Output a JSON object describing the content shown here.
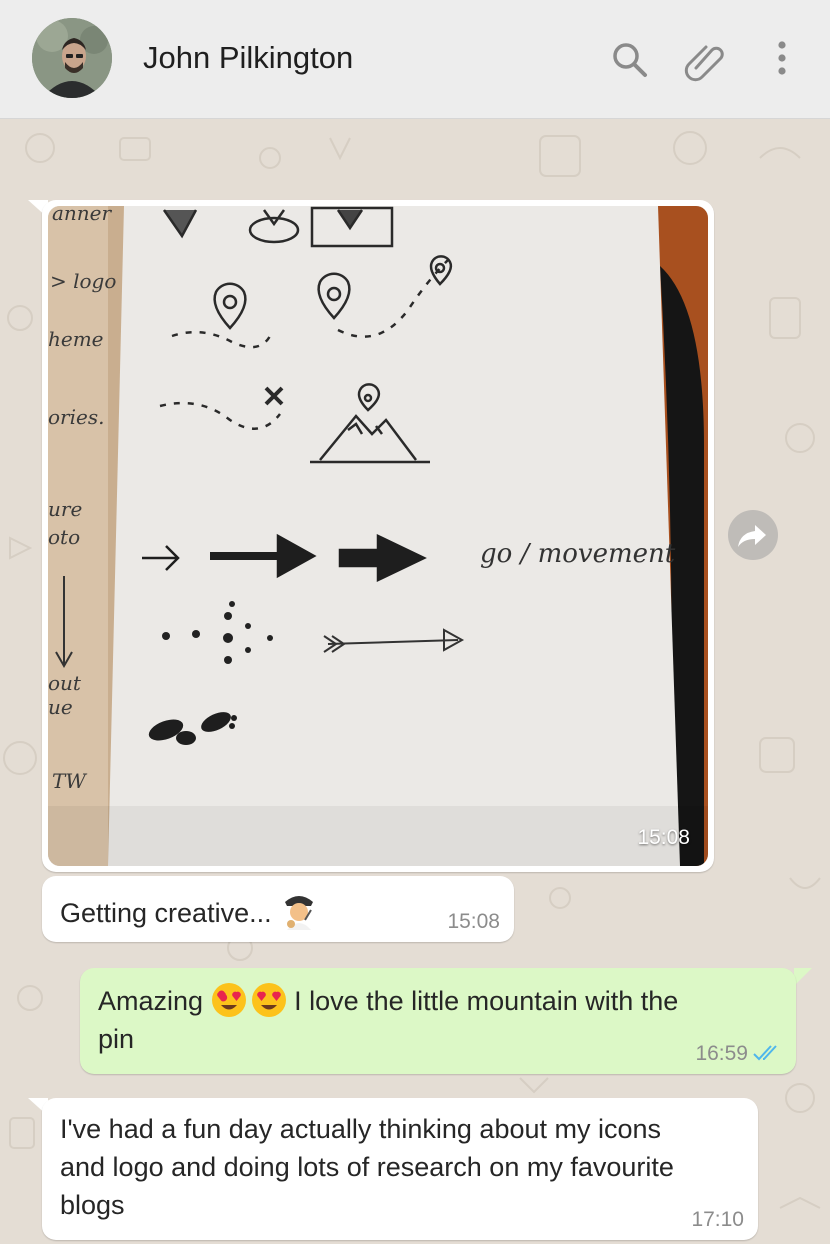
{
  "header": {
    "contact_name": "John Pilkington",
    "icons": [
      "search-icon",
      "paperclip-icon",
      "more-vertical-icon"
    ]
  },
  "messages": [
    {
      "direction": "incoming",
      "type": "image",
      "time": "15:08"
    },
    {
      "direction": "incoming",
      "type": "text",
      "text": "Getting creative...",
      "emoji": "artist",
      "time": "15:08"
    },
    {
      "direction": "outgoing",
      "type": "text",
      "text_before": "Amazing",
      "emoji": "heart-eyes x2",
      "text_line1_after": "I love the little mountain with the",
      "text_line2": "pin",
      "time": "16:59",
      "status": "read"
    },
    {
      "direction": "incoming",
      "type": "text",
      "lines": [
        "I've had a fun day actually thinking about my icons",
        "and logo and doing lots of research on my favourite",
        "blogs"
      ],
      "time": "17:10"
    }
  ],
  "sketch_words": {
    "notebook_label": "go / movement",
    "margin_words": [
      "anner",
      "> logo",
      "heme",
      "ories.",
      "ure",
      "oto",
      "out",
      "ue",
      "TW"
    ]
  },
  "colors": {
    "header_bg": "#ededed",
    "chat_bg": "#e4ddd4",
    "outgoing_bubble": "#dcf8c6",
    "incoming_bubble": "#ffffff",
    "read_ticks": "#4fb6ec"
  }
}
